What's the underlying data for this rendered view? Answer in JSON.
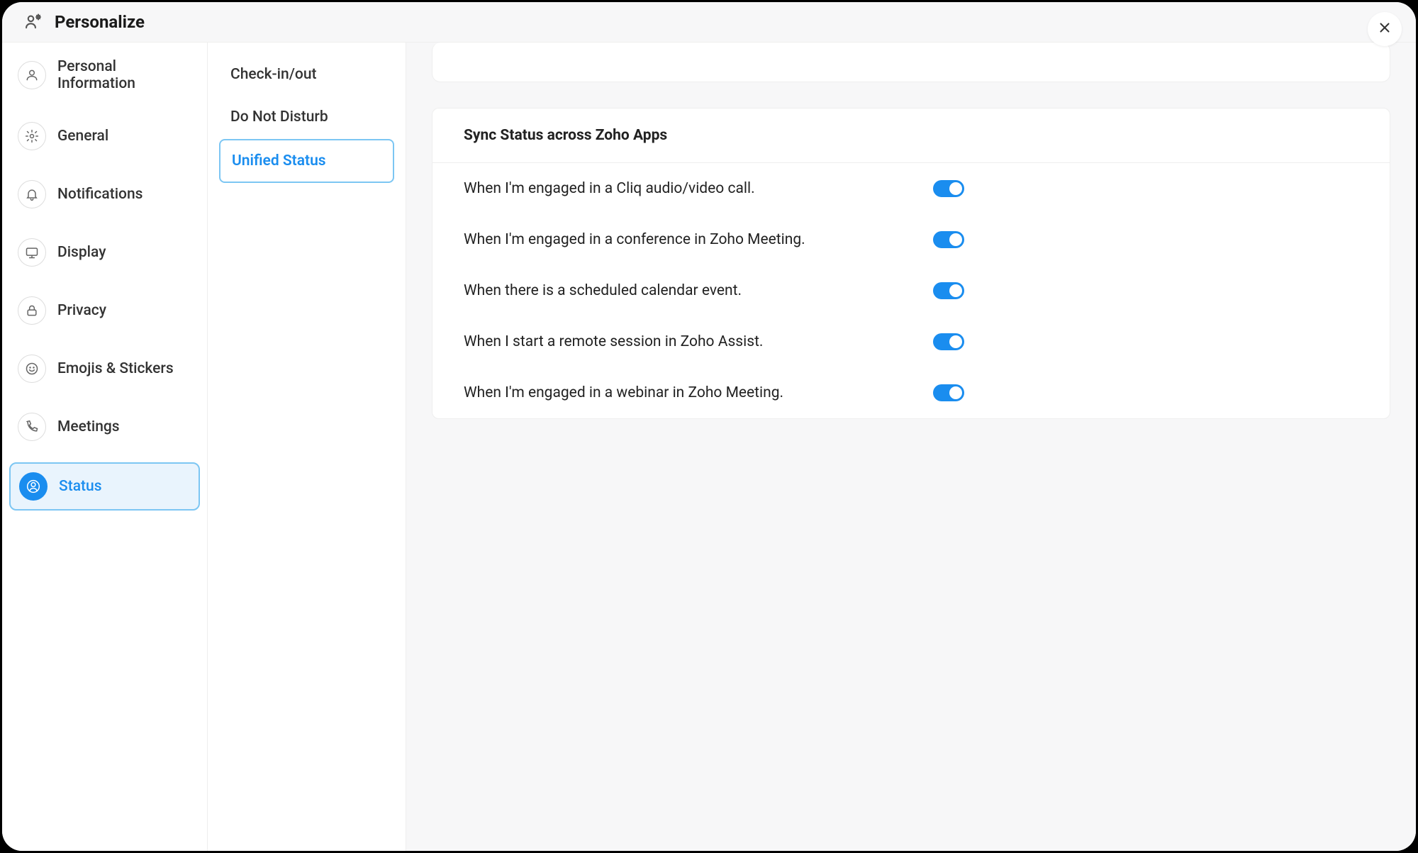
{
  "header": {
    "title": "Personalize"
  },
  "sidebar": {
    "items": [
      {
        "label": "Personal Information"
      },
      {
        "label": "General"
      },
      {
        "label": "Notifications"
      },
      {
        "label": "Display"
      },
      {
        "label": "Privacy"
      },
      {
        "label": "Emojis & Stickers"
      },
      {
        "label": "Meetings"
      },
      {
        "label": "Status"
      }
    ]
  },
  "subsidebar": {
    "items": [
      {
        "label": "Check-in/out"
      },
      {
        "label": "Do Not Disturb"
      },
      {
        "label": "Unified Status"
      }
    ]
  },
  "panel": {
    "title": "Sync Status across Zoho Apps",
    "rows": [
      {
        "label": "When I'm engaged in a Cliq audio/video call.",
        "on": true
      },
      {
        "label": "When I'm engaged in a conference in Zoho Meeting.",
        "on": true
      },
      {
        "label": "When there is a scheduled calendar event.",
        "on": true
      },
      {
        "label": "When I start a remote session in Zoho Assist.",
        "on": true
      },
      {
        "label": "When I'm engaged in a webinar in Zoho Meeting.",
        "on": true
      }
    ]
  }
}
